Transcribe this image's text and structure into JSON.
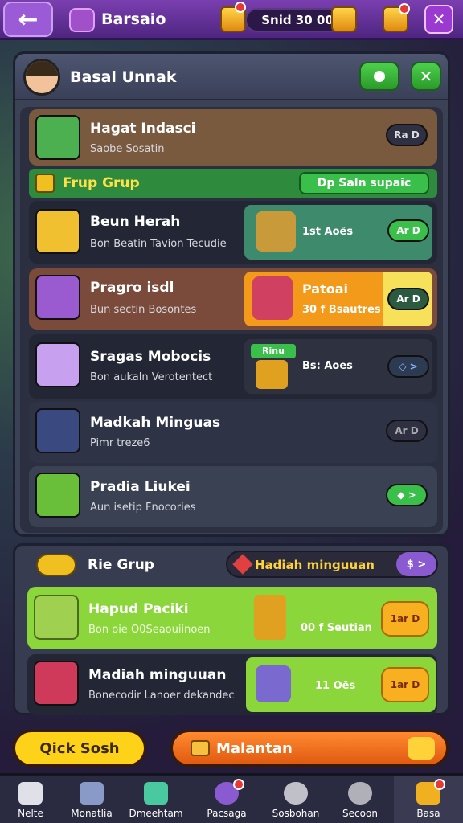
{
  "topbar": {
    "title": "Barsaio",
    "currency": "Snid 30 00"
  },
  "panel": {
    "header_title": "Basal Unnak",
    "rows": [
      {
        "title": "Hagat Indasci",
        "subtitle": "Saobe Sosatin",
        "btn": "Ra D"
      },
      {
        "title": "Beun Herah",
        "subtitle": "Bon Beatin Tavion Tecudie",
        "side_text": "1st Aoës",
        "side_label": "",
        "btn": "Ar D"
      },
      {
        "title": "Pragro isdl",
        "subtitle": "Bun sectin Bosontes",
        "side_title": "Patoai",
        "side_text": "30 f Bsautres",
        "btn": "Ar D"
      },
      {
        "title": "Sragas Mobocis",
        "subtitle": "Bon aukaln Verotentect",
        "side_badge": "Rinu",
        "side_text": "Bs: Aoes",
        "btn": "◇ >"
      },
      {
        "title": "Madkah Minguas",
        "subtitle": "Pimr treze6",
        "btn": "Ar D"
      },
      {
        "title": "Pradia Liukei",
        "subtitle": "Aun isetip Fnocories",
        "btn": "◆ >"
      }
    ],
    "group": {
      "label": "Frup Grup",
      "right": "Dp Saln supaic"
    }
  },
  "panel2": {
    "title": "Rie Grup",
    "right_label": "Hadiah minguuan",
    "right_btn": "$ >",
    "rows": [
      {
        "title": "Hapud Paciki",
        "subtitle": "Bon oie O0Seaouiinoen",
        "side_text": "00 f Seutian",
        "btn": "1ar D"
      },
      {
        "title": "Madiah minguuan",
        "subtitle": "Bonecodir Lanoer dekandec",
        "side_text": "11 Oës",
        "btn": "1ar D"
      }
    ]
  },
  "bottom": {
    "left_btn": "Qick Sosh",
    "right_btn": "Malantan"
  },
  "nav": [
    "Nelte",
    "Monatlia",
    "Dmeehtam",
    "Pacsaga",
    "Sosbohan",
    "Secoon",
    "Basa"
  ],
  "colors": {
    "topbar": "#5b2d96",
    "panel": "#3c4256",
    "green": "#3cc43c",
    "orange": "#f39a1a",
    "lime": "#8bd63a"
  }
}
